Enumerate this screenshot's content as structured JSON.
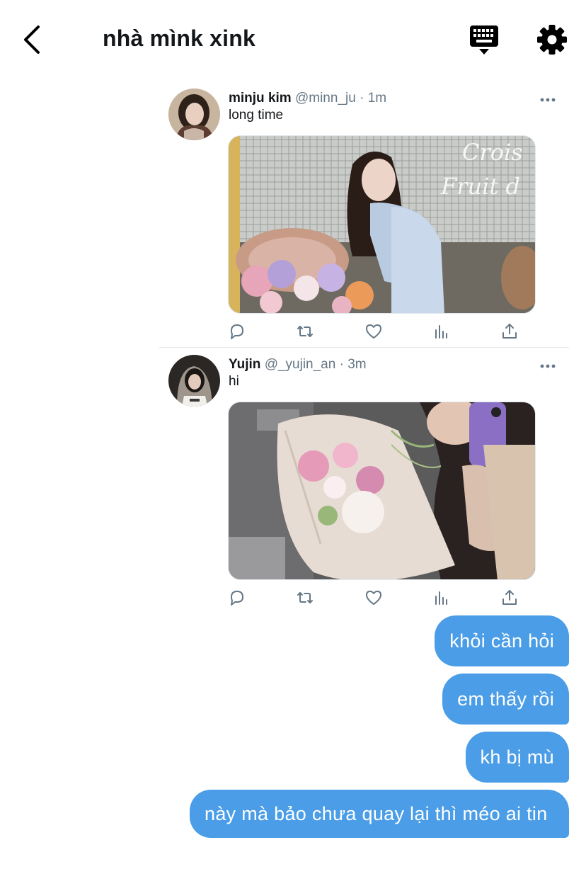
{
  "header": {
    "title": "nhà mìnk xink",
    "back_icon": "chevron-left-icon",
    "keyboard_icon": "keyboard-icon",
    "settings_icon": "gear-icon"
  },
  "tweets": [
    {
      "name": "minju kim",
      "handle": "@minn_ju",
      "separator": "·",
      "time": "1m",
      "text": "long time",
      "media_overlay": [
        "Crois",
        "Fruit d"
      ]
    },
    {
      "name": "Yujin",
      "handle": "@_yujin_an",
      "separator": "·",
      "time": "3m",
      "text": "hi"
    }
  ],
  "action_icons": [
    "reply-icon",
    "retweet-icon",
    "like-icon",
    "analytics-icon",
    "share-icon"
  ],
  "messages": [
    "khỏi cần hỏi",
    "em thấy rồi",
    "kh bị mù",
    "này mà bảo chưa quay lại thì méo ai tin"
  ],
  "colors": {
    "bubble": "#4a9de6",
    "secondary_text": "#657786",
    "icon": "#000000"
  }
}
